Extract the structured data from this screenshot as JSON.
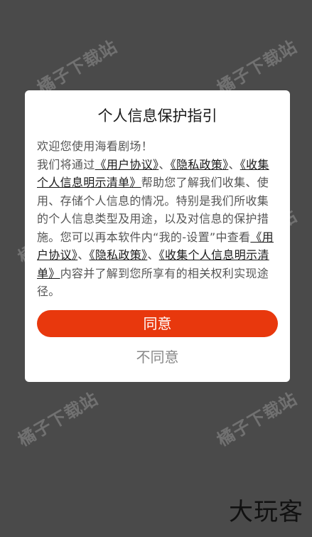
{
  "dialog": {
    "title": "个人信息保护指引",
    "greeting": "欢迎您使用海看剧场！",
    "body": {
      "t1": "我们将通过",
      "link_user_agreement": "《用户协议》",
      "sep1": "、",
      "link_privacy_policy": "《隐私政策》",
      "sep2": "、",
      "link_collection_list": "《收集个人信息明示清单》",
      "t2": "帮助您了解我们收集、使用、存储个人信息的情况。特别是我们所收集的个人信息类型及用途，以及对信息的保护措施。您可以再本软件内“我的-设置”中查看",
      "link_user_agreement_2": "《用户协议》",
      "sep3": "、",
      "link_privacy_policy_2": "《隐私政策》",
      "sep4": "、",
      "link_collection_list_2": "《收集个人信息明示清单》",
      "t3": "内容并了解到您所享有的相关权利实现途径。"
    },
    "agree_label": "同意",
    "disagree_label": "不同意"
  },
  "watermarks": [
    "橘子下载站",
    "橘子下载站",
    "橘子下载站",
    "橘子下载站",
    "橘子下载站",
    "橘子下载站"
  ],
  "brand": "大玩客",
  "colors": {
    "overlay": "#4a4a4a",
    "accent": "#e8380d",
    "dialog_bg": "#ffffff"
  }
}
